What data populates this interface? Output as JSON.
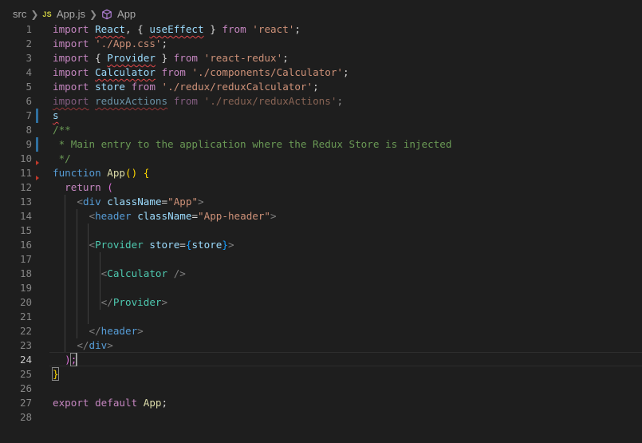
{
  "breadcrumb": {
    "folder": "src",
    "file_badge": "JS",
    "file": "App.js",
    "symbol": "App",
    "icons": [
      "chevron-right-icon",
      "js-file-icon",
      "cube-icon"
    ]
  },
  "editor": {
    "active_line": 24,
    "lines": [
      {
        "n": "1"
      },
      {
        "n": "2"
      },
      {
        "n": "3"
      },
      {
        "n": "4"
      },
      {
        "n": "5"
      },
      {
        "n": "6"
      },
      {
        "n": "7"
      },
      {
        "n": "8"
      },
      {
        "n": "9"
      },
      {
        "n": "10"
      },
      {
        "n": "11"
      },
      {
        "n": "12"
      },
      {
        "n": "13"
      },
      {
        "n": "14"
      },
      {
        "n": "15"
      },
      {
        "n": "16"
      },
      {
        "n": "17"
      },
      {
        "n": "18"
      },
      {
        "n": "19"
      },
      {
        "n": "20"
      },
      {
        "n": "21"
      },
      {
        "n": "22"
      },
      {
        "n": "23"
      },
      {
        "n": "24"
      },
      {
        "n": "25"
      },
      {
        "n": "26"
      },
      {
        "n": "27"
      },
      {
        "n": "28"
      }
    ],
    "code": {
      "l1": [
        "import",
        " ",
        "React",
        ", { ",
        "useEffect",
        " } ",
        "from",
        " ",
        "'react'",
        ";"
      ],
      "l2": [
        "import",
        " ",
        "'./App.css'",
        ";"
      ],
      "l3": [
        "import",
        " { ",
        "Provider",
        " } ",
        "from",
        " ",
        "'react-redux'",
        ";"
      ],
      "l4": [
        "import",
        " ",
        "Calculator",
        " ",
        "from",
        " ",
        "'./components/Calculator'",
        ";"
      ],
      "l5": [
        "import",
        " ",
        "store",
        " ",
        "from",
        " ",
        "'./redux/reduxCalculator'",
        ";"
      ],
      "l6": [
        "import",
        " ",
        "reduxActions",
        " ",
        "from",
        " ",
        "'./redux/reduxActions'",
        ";"
      ],
      "l7": [
        "s"
      ],
      "l8": [
        "/**"
      ],
      "l9": [
        " * Main entry to the application where the Redux Store is injected"
      ],
      "l10": [
        " */"
      ],
      "l11": [
        "function",
        " ",
        "App",
        "() ",
        "{"
      ],
      "l12": [
        "  ",
        "return",
        " ("
      ],
      "l13": [
        "    ",
        "<",
        "div",
        " ",
        "className",
        "=",
        "\"App\"",
        ">"
      ],
      "l14": [
        "      ",
        "<",
        "header",
        " ",
        "className",
        "=",
        "\"App-header\"",
        ">"
      ],
      "l16": [
        "      ",
        "<",
        "Provider",
        " ",
        "store",
        "=",
        "{",
        "store",
        "}",
        ">"
      ],
      "l18": [
        "        ",
        "<",
        "Calculator",
        " ",
        "/>"
      ],
      "l20": [
        "        ",
        "</",
        "Provider",
        ">"
      ],
      "l22": [
        "      ",
        "</",
        "header",
        ">"
      ],
      "l23": [
        "    ",
        "</",
        "div",
        ">"
      ],
      "l24": [
        "  );"
      ],
      "l25": [
        "}"
      ],
      "l27": [
        "export",
        " ",
        "default",
        " ",
        "App",
        ";"
      ]
    }
  },
  "colors": {
    "background": "#1e1e1e",
    "keyword": "#569cd6",
    "control_keyword": "#c586c0",
    "variable": "#9cdcfe",
    "function": "#dcdcaa",
    "string": "#ce9178",
    "comment": "#6a9955",
    "component": "#4ec9b0",
    "error_squiggle": "#e2484b",
    "git_modified_bar": "#2f6f9f"
  }
}
